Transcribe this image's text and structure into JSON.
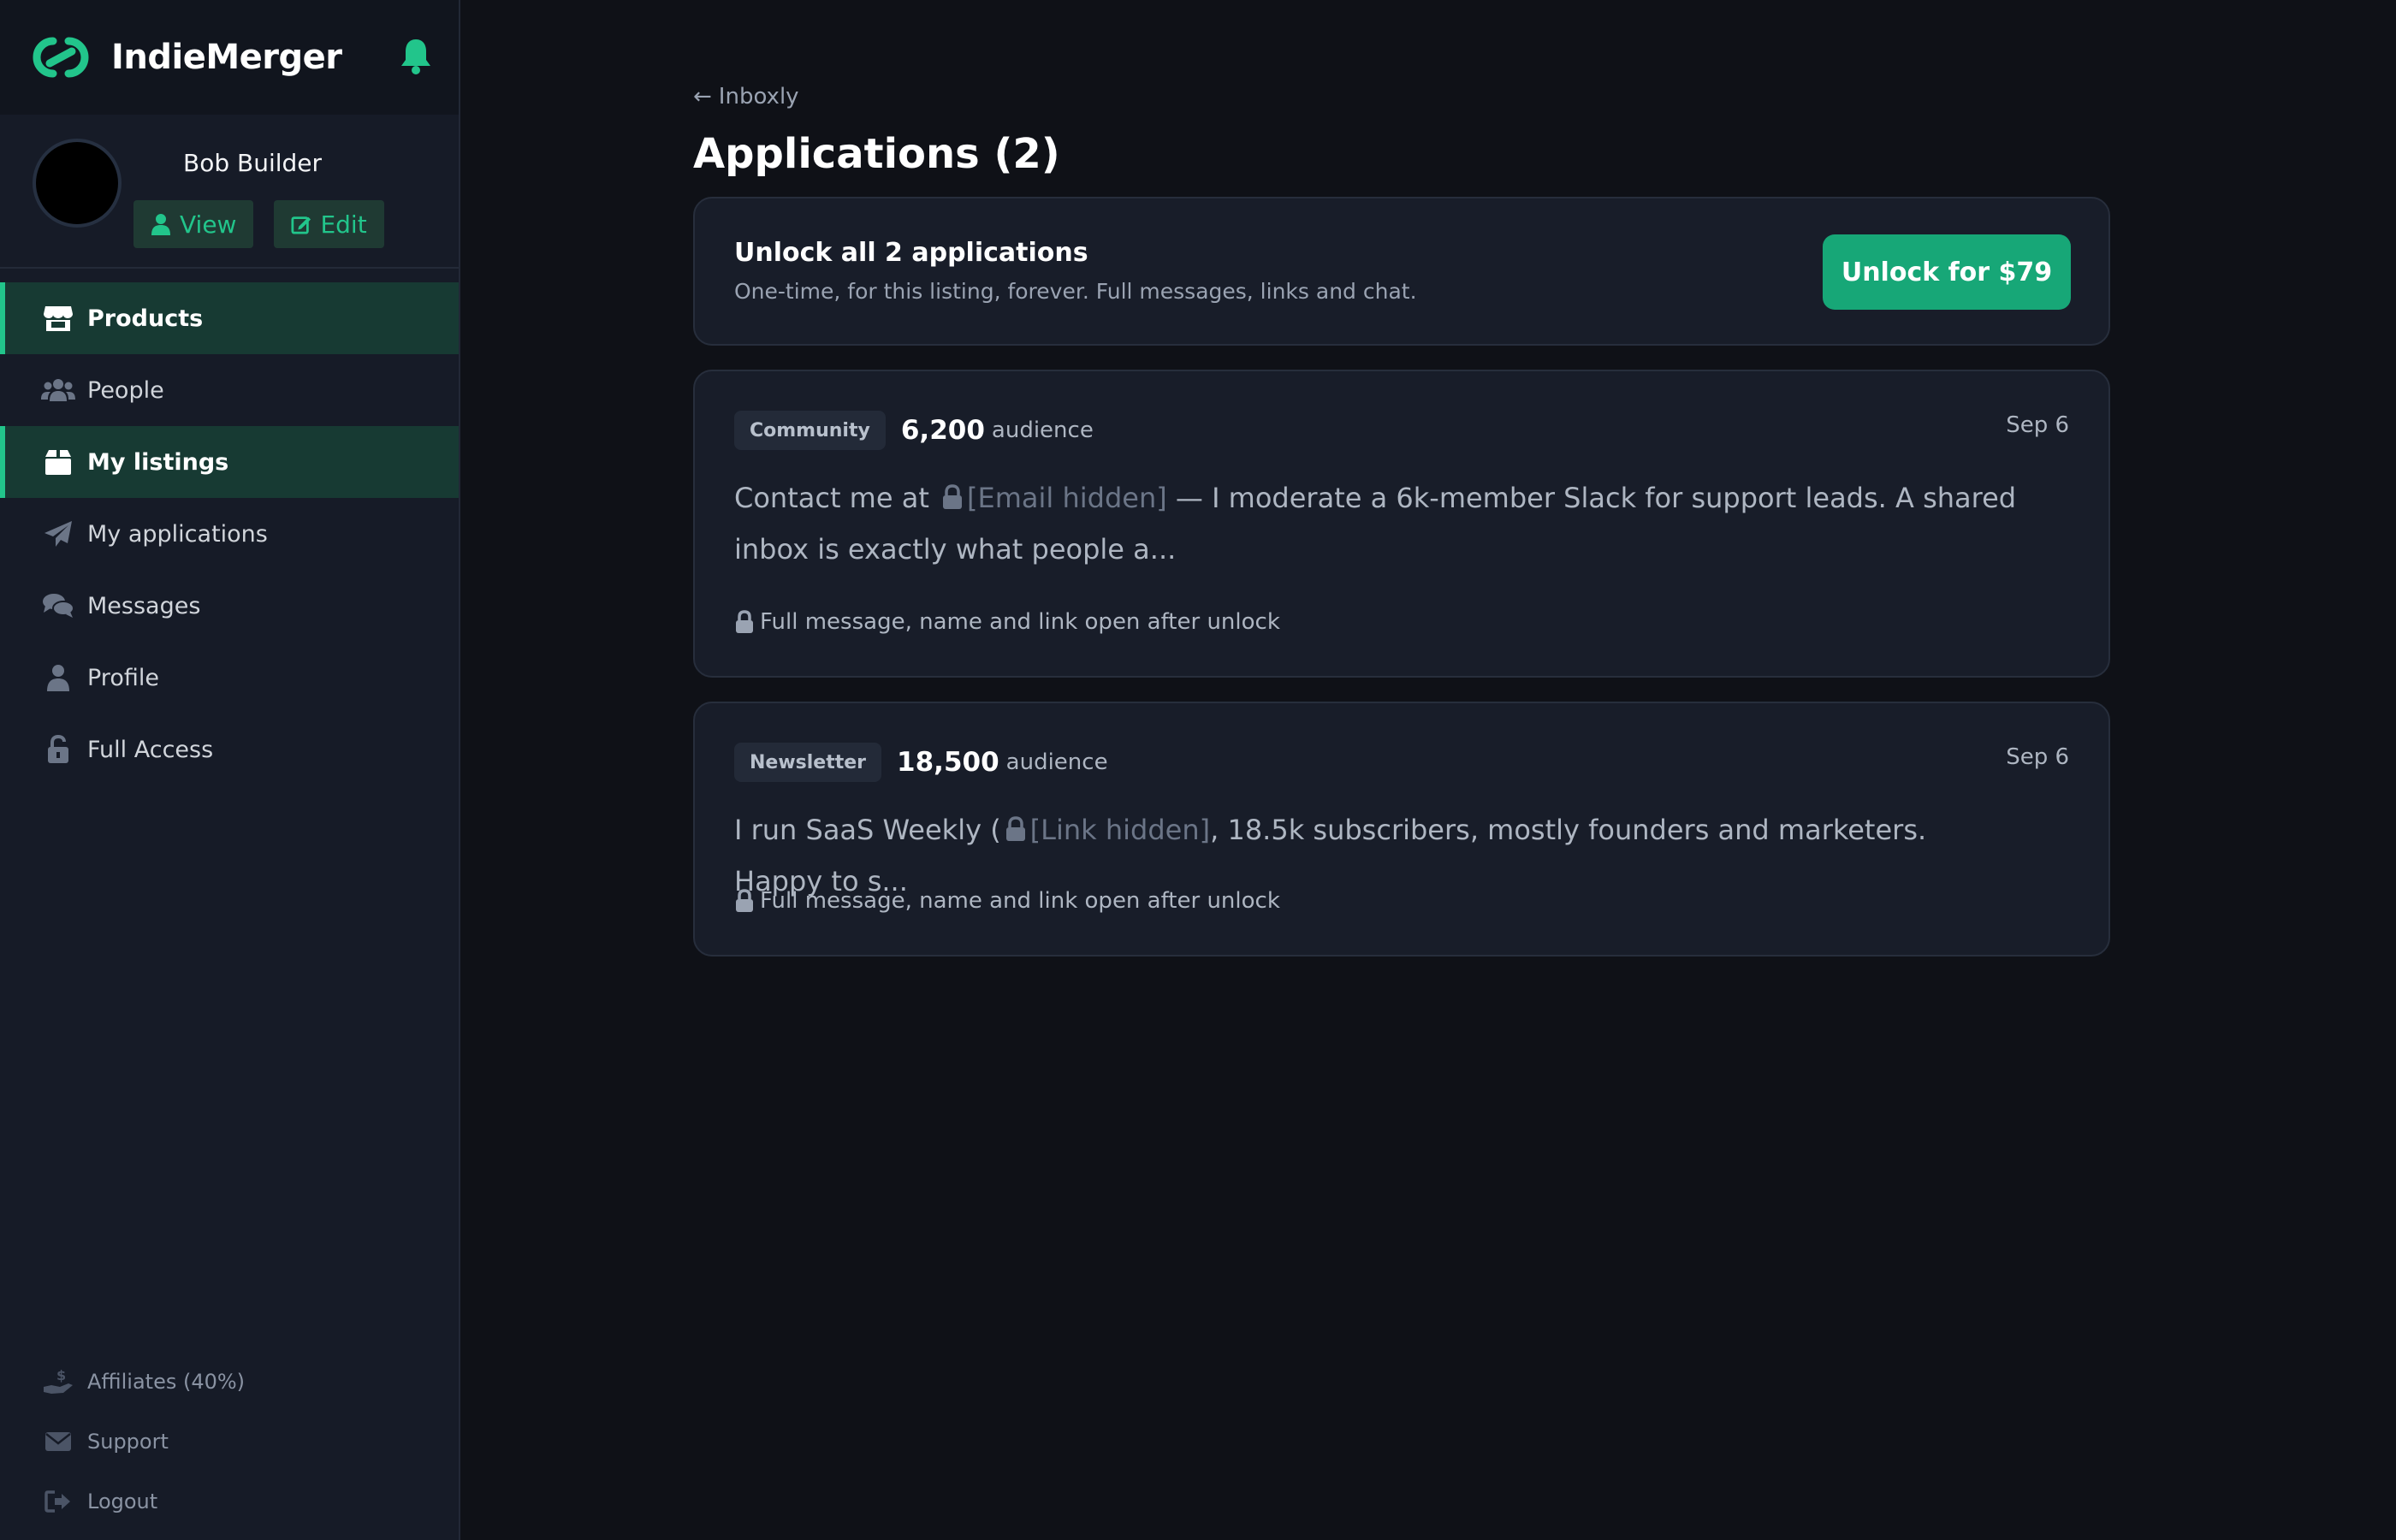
{
  "brand": {
    "name": "IndieMerger"
  },
  "user": {
    "name": "Bob Builder",
    "view_label": "View",
    "edit_label": "Edit"
  },
  "nav": {
    "items": [
      {
        "label": "Products",
        "icon": "store-icon",
        "active": true
      },
      {
        "label": "People",
        "icon": "users-icon",
        "active": false
      },
      {
        "label": "My listings",
        "icon": "box-icon",
        "active": true
      },
      {
        "label": "My applications",
        "icon": "paper-plane-icon",
        "active": false
      },
      {
        "label": "Messages",
        "icon": "chat-icon",
        "active": false
      },
      {
        "label": "Profile",
        "icon": "user-icon",
        "active": false
      },
      {
        "label": "Full Access",
        "icon": "unlock-icon",
        "active": false
      }
    ],
    "bottom": [
      {
        "label": "Affiliates (40%)",
        "icon": "dollar-hand-icon"
      },
      {
        "label": "Support",
        "icon": "envelope-icon"
      },
      {
        "label": "Logout",
        "icon": "logout-icon"
      }
    ]
  },
  "main": {
    "back_label": "Inboxly",
    "title": "Applications (2)",
    "unlock": {
      "title": "Unlock all 2 applications",
      "subtitle": "One-time, for this listing, forever. Full messages, links and chat.",
      "button": "Unlock for $79"
    },
    "applications": [
      {
        "tag": "Community",
        "audience": "6,200",
        "audience_label": "audience",
        "date": "Sep 6",
        "msg_pre": "Contact me at ",
        "hidden": "[Email hidden]",
        "msg_post": " — I moderate a 6k-member Slack for support leads. A shared inbox is exactly what people a...",
        "note": "Full message, name and link open after unlock"
      },
      {
        "tag": "Newsletter",
        "audience": "18,500",
        "audience_label": "audience",
        "date": "Sep 6",
        "msg_pre": "I run SaaS Weekly (",
        "hidden": "[Link hidden]",
        "msg_post": ", 18.5k subscribers, mostly founders and marketers. Happy to s...",
        "note": "Full message, name and link open after unlock"
      }
    ]
  },
  "colors": {
    "accent": "#22c58b",
    "button": "#17a777",
    "background": "#0f1117",
    "sidebar": "#161b27"
  }
}
